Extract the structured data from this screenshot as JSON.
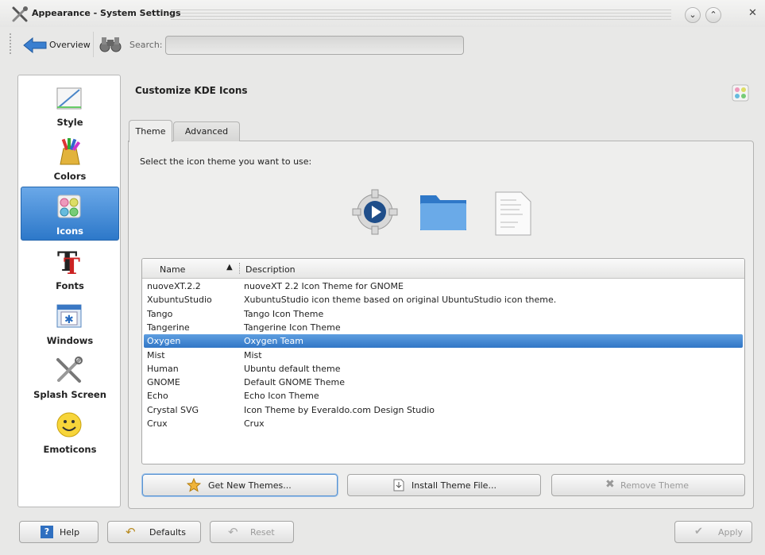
{
  "window": {
    "title": "Appearance - System Settings",
    "minimize_glyph": "⌄",
    "maximize_glyph": "⌃",
    "close_glyph": "✕"
  },
  "toolbar": {
    "back_label": "Overview",
    "search_label": "Search:",
    "search_value": ""
  },
  "sidebar": {
    "items": [
      {
        "label": "Style",
        "icon": "style-icon"
      },
      {
        "label": "Colors",
        "icon": "colors-icon"
      },
      {
        "label": "Icons",
        "icon": "icons-icon",
        "active": true
      },
      {
        "label": "Fonts",
        "icon": "fonts-icon"
      },
      {
        "label": "Windows",
        "icon": "windows-icon"
      },
      {
        "label": "Splash Screen",
        "icon": "splash-screen-icon"
      },
      {
        "label": "Emoticons",
        "icon": "emoticons-icon"
      }
    ]
  },
  "main": {
    "title": "Customize KDE Icons",
    "tabs": [
      {
        "label": "Theme",
        "active": true
      },
      {
        "label": "Advanced"
      }
    ],
    "instruction": "Select the icon theme you want to use:",
    "list": {
      "columns": [
        "Name",
        "Description"
      ],
      "rows": [
        {
          "name": "nuoveXT.2.2",
          "description": "nuoveXT 2.2 Icon Theme for GNOME"
        },
        {
          "name": "XubuntuStudio",
          "description": "XubuntuStudio icon theme based on original UbuntuStudio icon theme."
        },
        {
          "name": "Tango",
          "description": "Tango Icon Theme"
        },
        {
          "name": "Tangerine",
          "description": "Tangerine Icon Theme"
        },
        {
          "name": "Oxygen",
          "description": "Oxygen Team",
          "selected": true
        },
        {
          "name": "Mist",
          "description": "Mist"
        },
        {
          "name": "Human",
          "description": "Ubuntu default theme"
        },
        {
          "name": "GNOME",
          "description": "Default GNOME Theme"
        },
        {
          "name": "Echo",
          "description": "Echo Icon Theme"
        },
        {
          "name": "Crystal SVG",
          "description": "Icon Theme by Everaldo.com Design Studio"
        },
        {
          "name": "Crux",
          "description": "Crux"
        }
      ]
    },
    "buttons": {
      "get_new": "Get New Themes...",
      "install": "Install Theme File...",
      "remove": "Remove Theme"
    }
  },
  "footer": {
    "help": "Help",
    "defaults": "Defaults",
    "reset": "Reset",
    "apply": "Apply"
  },
  "colors": {
    "selection": "#3176c6",
    "accent": "#2d78c9"
  }
}
